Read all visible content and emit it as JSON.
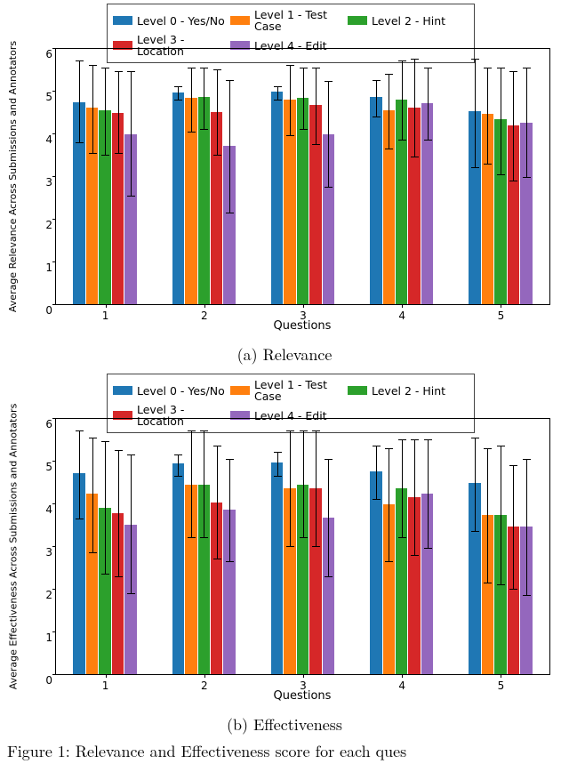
{
  "captions": {
    "a": "(a) Relevance",
    "b": "(b) Effectiveness",
    "figline": "Figure 1: Relevance and Effectiveness score for each ques"
  },
  "legend_items": [
    {
      "name": "Level 0 - Yes/No",
      "color": "#1f77b4"
    },
    {
      "name": "Level 1 - Test Case",
      "color": "#ff7f0e"
    },
    {
      "name": "Level 2 - Hint",
      "color": "#2ca02c"
    },
    {
      "name": "Level 3 - Location",
      "color": "#d62728"
    },
    {
      "name": "Level 4 - Edit",
      "color": "#9467bd"
    }
  ],
  "chart_data": [
    {
      "id": "relevance",
      "type": "bar",
      "title": "",
      "xlabel": "Questions",
      "ylabel": "Average Relevance Across Submissions and Annotators",
      "categories": [
        "1",
        "2",
        "3",
        "4",
        "5"
      ],
      "ylim": [
        0,
        6
      ],
      "yticks": [
        0,
        1,
        2,
        3,
        4,
        5,
        6
      ],
      "series": [
        {
          "name": "Level 0 - Yes/No",
          "values": [
            4.72,
            4.95,
            4.97,
            4.85,
            4.53
          ],
          "err_low": [
            3.8,
            4.8,
            4.8,
            4.4,
            3.2
          ],
          "err_high": [
            5.7,
            5.1,
            5.1,
            5.25,
            5.75
          ]
        },
        {
          "name": "Level 1 - Test Case",
          "values": [
            4.6,
            4.83,
            4.8,
            4.55,
            4.45
          ],
          "err_low": [
            3.55,
            4.05,
            3.95,
            3.65,
            3.3
          ],
          "err_high": [
            5.6,
            5.55,
            5.6,
            5.4,
            5.55
          ]
        },
        {
          "name": "Level 2 - Hint",
          "values": [
            4.55,
            4.85,
            4.83,
            4.8,
            4.33
          ],
          "err_low": [
            3.5,
            4.1,
            4.1,
            3.85,
            3.05
          ],
          "err_high": [
            5.55,
            5.55,
            5.55,
            5.7,
            5.55
          ]
        },
        {
          "name": "Level 3 - Location",
          "values": [
            4.47,
            4.5,
            4.67,
            4.6,
            4.18
          ],
          "err_low": [
            3.55,
            3.5,
            3.75,
            3.45,
            2.9
          ],
          "err_high": [
            5.45,
            5.5,
            5.55,
            5.75,
            5.45
          ]
        },
        {
          "name": "Level 4 - Edit",
          "values": [
            3.98,
            3.7,
            3.98,
            4.7,
            4.25
          ],
          "err_low": [
            2.55,
            2.15,
            2.75,
            3.85,
            2.98
          ],
          "err_high": [
            5.45,
            5.25,
            5.22,
            5.55,
            5.55
          ]
        }
      ]
    },
    {
      "id": "effectiveness",
      "type": "bar",
      "title": "",
      "xlabel": "Questions",
      "ylabel": "Average Effectiveness Across Submissions and Annotators",
      "categories": [
        "1",
        "2",
        "3",
        "4",
        "5"
      ],
      "ylim": [
        0,
        6
      ],
      "yticks": [
        0,
        1,
        2,
        3,
        4,
        5,
        6
      ],
      "series": [
        {
          "name": "Level 0 - Yes/No",
          "values": [
            4.7,
            4.93,
            4.95,
            4.75,
            4.48
          ],
          "err_low": [
            3.65,
            4.65,
            4.65,
            4.1,
            3.35
          ],
          "err_high": [
            5.7,
            5.15,
            5.2,
            5.35,
            5.55
          ]
        },
        {
          "name": "Level 1 - Test Case",
          "values": [
            4.22,
            4.43,
            4.35,
            3.98,
            3.73
          ],
          "err_low": [
            2.85,
            3.2,
            3.0,
            2.65,
            2.15
          ],
          "err_high": [
            5.55,
            5.7,
            5.7,
            5.3,
            5.3
          ]
        },
        {
          "name": "Level 2 - Hint",
          "values": [
            3.9,
            4.43,
            4.43,
            4.35,
            3.72
          ],
          "err_low": [
            2.35,
            3.2,
            3.2,
            3.2,
            2.1
          ],
          "err_high": [
            5.45,
            5.7,
            5.7,
            5.5,
            5.35
          ]
        },
        {
          "name": "Level 3 - Location",
          "values": [
            3.77,
            4.02,
            4.35,
            4.15,
            3.45
          ],
          "err_low": [
            2.3,
            2.7,
            3.0,
            2.8,
            2.0
          ],
          "err_high": [
            5.25,
            5.35,
            5.7,
            5.5,
            4.9
          ]
        },
        {
          "name": "Level 4 - Edit",
          "values": [
            3.5,
            3.85,
            3.67,
            4.22,
            3.45
          ],
          "err_low": [
            1.9,
            2.65,
            2.3,
            2.95,
            1.85
          ],
          "err_high": [
            5.15,
            5.05,
            5.05,
            5.5,
            5.05
          ]
        }
      ]
    }
  ]
}
